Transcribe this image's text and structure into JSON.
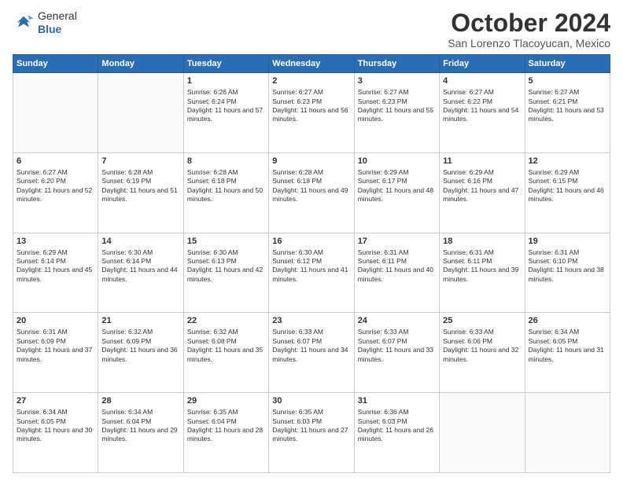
{
  "header": {
    "logo_general": "General",
    "logo_blue": "Blue",
    "month": "October 2024",
    "location": "San Lorenzo Tlacoyucan, Mexico"
  },
  "weekdays": [
    "Sunday",
    "Monday",
    "Tuesday",
    "Wednesday",
    "Thursday",
    "Friday",
    "Saturday"
  ],
  "weeks": [
    [
      {
        "day": "",
        "info": ""
      },
      {
        "day": "",
        "info": ""
      },
      {
        "day": "1",
        "info": "Sunrise: 6:26 AM\nSunset: 6:24 PM\nDaylight: 11 hours and 57 minutes."
      },
      {
        "day": "2",
        "info": "Sunrise: 6:27 AM\nSunset: 6:23 PM\nDaylight: 11 hours and 56 minutes."
      },
      {
        "day": "3",
        "info": "Sunrise: 6:27 AM\nSunset: 6:23 PM\nDaylight: 11 hours and 55 minutes."
      },
      {
        "day": "4",
        "info": "Sunrise: 6:27 AM\nSunset: 6:22 PM\nDaylight: 11 hours and 54 minutes."
      },
      {
        "day": "5",
        "info": "Sunrise: 6:27 AM\nSunset: 6:21 PM\nDaylight: 11 hours and 53 minutes."
      }
    ],
    [
      {
        "day": "6",
        "info": "Sunrise: 6:27 AM\nSunset: 6:20 PM\nDaylight: 11 hours and 52 minutes."
      },
      {
        "day": "7",
        "info": "Sunrise: 6:28 AM\nSunset: 6:19 PM\nDaylight: 11 hours and 51 minutes."
      },
      {
        "day": "8",
        "info": "Sunrise: 6:28 AM\nSunset: 6:18 PM\nDaylight: 11 hours and 50 minutes."
      },
      {
        "day": "9",
        "info": "Sunrise: 6:28 AM\nSunset: 6:18 PM\nDaylight: 11 hours and 49 minutes."
      },
      {
        "day": "10",
        "info": "Sunrise: 6:29 AM\nSunset: 6:17 PM\nDaylight: 11 hours and 48 minutes."
      },
      {
        "day": "11",
        "info": "Sunrise: 6:29 AM\nSunset: 6:16 PM\nDaylight: 11 hours and 47 minutes."
      },
      {
        "day": "12",
        "info": "Sunrise: 6:29 AM\nSunset: 6:15 PM\nDaylight: 11 hours and 46 minutes."
      }
    ],
    [
      {
        "day": "13",
        "info": "Sunrise: 6:29 AM\nSunset: 6:14 PM\nDaylight: 11 hours and 45 minutes."
      },
      {
        "day": "14",
        "info": "Sunrise: 6:30 AM\nSunset: 6:14 PM\nDaylight: 11 hours and 44 minutes."
      },
      {
        "day": "15",
        "info": "Sunrise: 6:30 AM\nSunset: 6:13 PM\nDaylight: 11 hours and 42 minutes."
      },
      {
        "day": "16",
        "info": "Sunrise: 6:30 AM\nSunset: 6:12 PM\nDaylight: 11 hours and 41 minutes."
      },
      {
        "day": "17",
        "info": "Sunrise: 6:31 AM\nSunset: 6:11 PM\nDaylight: 11 hours and 40 minutes."
      },
      {
        "day": "18",
        "info": "Sunrise: 6:31 AM\nSunset: 6:11 PM\nDaylight: 11 hours and 39 minutes."
      },
      {
        "day": "19",
        "info": "Sunrise: 6:31 AM\nSunset: 6:10 PM\nDaylight: 11 hours and 38 minutes."
      }
    ],
    [
      {
        "day": "20",
        "info": "Sunrise: 6:31 AM\nSunset: 6:09 PM\nDaylight: 11 hours and 37 minutes."
      },
      {
        "day": "21",
        "info": "Sunrise: 6:32 AM\nSunset: 6:09 PM\nDaylight: 11 hours and 36 minutes."
      },
      {
        "day": "22",
        "info": "Sunrise: 6:32 AM\nSunset: 6:08 PM\nDaylight: 11 hours and 35 minutes."
      },
      {
        "day": "23",
        "info": "Sunrise: 6:33 AM\nSunset: 6:07 PM\nDaylight: 11 hours and 34 minutes."
      },
      {
        "day": "24",
        "info": "Sunrise: 6:33 AM\nSunset: 6:07 PM\nDaylight: 11 hours and 33 minutes."
      },
      {
        "day": "25",
        "info": "Sunrise: 6:33 AM\nSunset: 6:06 PM\nDaylight: 11 hours and 32 minutes."
      },
      {
        "day": "26",
        "info": "Sunrise: 6:34 AM\nSunset: 6:05 PM\nDaylight: 11 hours and 31 minutes."
      }
    ],
    [
      {
        "day": "27",
        "info": "Sunrise: 6:34 AM\nSunset: 6:05 PM\nDaylight: 11 hours and 30 minutes."
      },
      {
        "day": "28",
        "info": "Sunrise: 6:34 AM\nSunset: 6:04 PM\nDaylight: 11 hours and 29 minutes."
      },
      {
        "day": "29",
        "info": "Sunrise: 6:35 AM\nSunset: 6:04 PM\nDaylight: 11 hours and 28 minutes."
      },
      {
        "day": "30",
        "info": "Sunrise: 6:35 AM\nSunset: 6:03 PM\nDaylight: 11 hours and 27 minutes."
      },
      {
        "day": "31",
        "info": "Sunrise: 6:36 AM\nSunset: 6:03 PM\nDaylight: 11 hours and 26 minutes."
      },
      {
        "day": "",
        "info": ""
      },
      {
        "day": "",
        "info": ""
      }
    ]
  ]
}
